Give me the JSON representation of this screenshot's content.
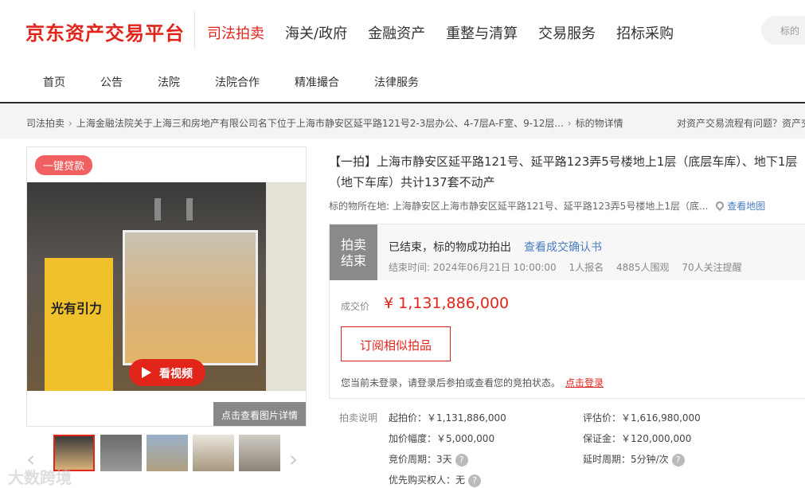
{
  "header": {
    "logo": "京东资产交易平台",
    "nav": [
      "司法拍卖",
      "海关/政府",
      "金融资产",
      "重整与清算",
      "交易服务",
      "招标采购"
    ],
    "search_placeholder": "标的",
    "subnav": [
      "首页",
      "公告",
      "法院",
      "法院合作",
      "精准撮合",
      "法律服务"
    ]
  },
  "breadcrumb": {
    "items": [
      "司法拍卖",
      "上海金融法院关于上海三和房地产有限公司名下位于上海市静安区延平路121号2-3层办公、4-7层A-F室、9-12层...",
      "标的物详情"
    ],
    "help": "对资产交易流程有问题？资产交"
  },
  "gallery": {
    "loan_pill": "一键贷款",
    "play_label": "看视频",
    "view_pics": "点击查看图片详情",
    "banner_text": "光有引力",
    "watermark": "大数跨境"
  },
  "item": {
    "title": "【一拍】上海市静安区延平路121号、延平路123弄5号楼地上1层（底层车库）、地下1层（地下车库）共计137套不动产",
    "location_label": "标的物所在地:",
    "location": "上海静安区上海市静安区延平路121号、延平路123弄5号楼地上1层（底...",
    "map_link": "查看地图"
  },
  "status": {
    "badge_line1": "拍卖",
    "badge_line2": "结束",
    "message": "已结束，标的物成功拍出",
    "confirm_link": "查看成交确认书",
    "end_time": "结束时间:  2024年06月21日 10:00:00",
    "signups": "1人报名",
    "views": "4885人围观",
    "followers": "70人关注提醒"
  },
  "deal": {
    "price_label": "成交价",
    "price": "¥ 1,131,886,000",
    "subscribe": "订阅相似拍品",
    "login_note": "您当前未登录，请登录后参拍或查看您的竞拍状态。",
    "login_link": "点击登录"
  },
  "auction_info": {
    "label": "拍卖说明",
    "start_price": "起拍价：￥1,131,886,000",
    "appraisal": "评估价：￥1,616,980,000",
    "increment": "加价幅度：￥5,000,000",
    "deposit": "保证金：￥120,000,000",
    "period": "竞价周期：3天",
    "delay": "延时周期：5分钟/次",
    "priority": "优先购买权人：无"
  },
  "colors": {
    "accent": "#e1251b",
    "link": "#4a7cc4"
  }
}
